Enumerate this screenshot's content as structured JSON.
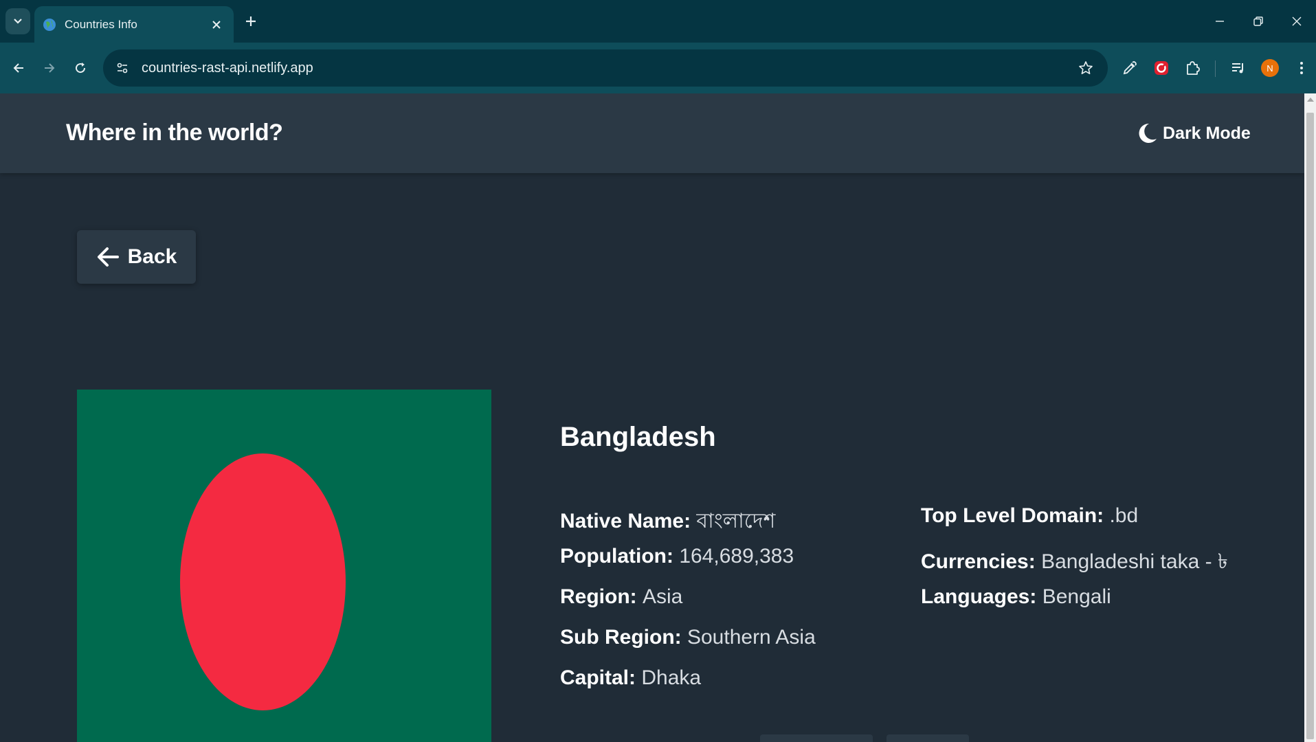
{
  "browser": {
    "tab_title": "Countries Info",
    "url": "countries-rast-api.netlify.app",
    "avatar_initial": "N"
  },
  "header": {
    "title": "Where in the world?",
    "mode_label": "Dark Mode"
  },
  "back_button": {
    "label": "Back"
  },
  "country": {
    "name": "Bangladesh",
    "flag": {
      "field_color": "#006a4e",
      "disc_color": "#f42a41"
    },
    "details_left": [
      {
        "label": "Native Name:",
        "value": "বাংলাদেশ"
      },
      {
        "label": "Population:",
        "value": "164,689,383"
      },
      {
        "label": "Region:",
        "value": "Asia"
      },
      {
        "label": "Sub Region:",
        "value": "Southern Asia"
      },
      {
        "label": "Capital:",
        "value": "Dhaka"
      }
    ],
    "details_right": [
      {
        "label": "Top Level Domain:",
        "value": ".bd"
      },
      {
        "label": "Currencies:",
        "value": "Bangladeshi taka - ৳"
      },
      {
        "label": "Languages:",
        "value": "Bengali"
      }
    ]
  },
  "theme": {
    "background": "#202c37",
    "element": "#2b3945",
    "chrome": "#0e4d5a",
    "chrome_dark": "#053542"
  }
}
